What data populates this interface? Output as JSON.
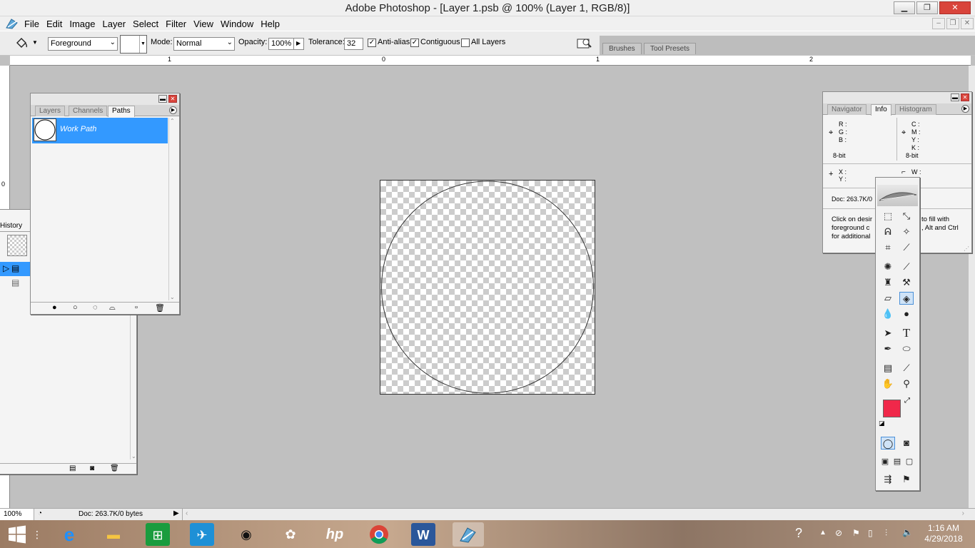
{
  "window": {
    "title": "Adobe Photoshop - [Layer 1.psb @ 100% (Layer 1, RGB/8)]",
    "minimize": "▁",
    "restore": "❐",
    "close": "✕"
  },
  "menu": {
    "items": [
      "File",
      "Edit",
      "Image",
      "Layer",
      "Select",
      "Filter",
      "View",
      "Window",
      "Help"
    ]
  },
  "doc_controls": {
    "minimize": "–",
    "restore": "❐",
    "close": "✕"
  },
  "options": {
    "fill_source": "Foreground",
    "mode_label": "Mode:",
    "mode_value": "Normal",
    "opacity_label": "Opacity:",
    "opacity_value": "100%",
    "tolerance_label": "Tolerance:",
    "tolerance_value": "32",
    "antialias_label": "Anti-alias",
    "antialias_checked": true,
    "contiguous_label": "Contiguous",
    "contiguous_checked": true,
    "alllayers_label": "All Layers",
    "alllayers_checked": false,
    "well_tabs": [
      "Brushes",
      "Tool Presets"
    ]
  },
  "ruler": {
    "h_labels": [
      "1",
      "0",
      "1",
      "2"
    ],
    "v_labels": [
      "0"
    ]
  },
  "paths_panel": {
    "tabs": [
      "Layers",
      "Channels",
      "Paths"
    ],
    "active_tab": "Paths",
    "item_name": "Work Path"
  },
  "history_panel": {
    "tab": "History"
  },
  "info_panel": {
    "tabs": [
      "Navigator",
      "Info",
      "Histogram"
    ],
    "active_tab": "Info",
    "rgb_labels": [
      "R :",
      "G :",
      "B :"
    ],
    "cmyk_labels": [
      "C :",
      "M :",
      "Y :",
      "K :"
    ],
    "bit_left": "8-bit",
    "bit_right": "8-bit",
    "xy_labels": [
      "X :",
      "Y :"
    ],
    "wh_labels": [
      "W :"
    ],
    "doc": "Doc: 263.7K/0",
    "hint_left": [
      "Click on desir",
      "foreground c",
      "for additional"
    ],
    "hint_right": [
      "to fill with",
      ", Alt and Ctrl"
    ]
  },
  "colors": {
    "foreground": "#f0284a",
    "background": "#ffffff",
    "selection": "#3399ff",
    "workspace": "#c0c0c0"
  },
  "status": {
    "zoom": "100%",
    "doc": "Doc: 263.7K/0 bytes"
  },
  "taskbar": {
    "time": "1:16 AM",
    "date": "4/29/2018",
    "apps": [
      "start-icon",
      "task-view-icon",
      "internet-explorer-icon",
      "file-explorer-icon",
      "store-icon",
      "rocket-app-icon",
      "media-app-icon",
      "photos-app-icon",
      "hp-icon",
      "chrome-icon",
      "word-icon",
      "photoshop-icon"
    ]
  }
}
